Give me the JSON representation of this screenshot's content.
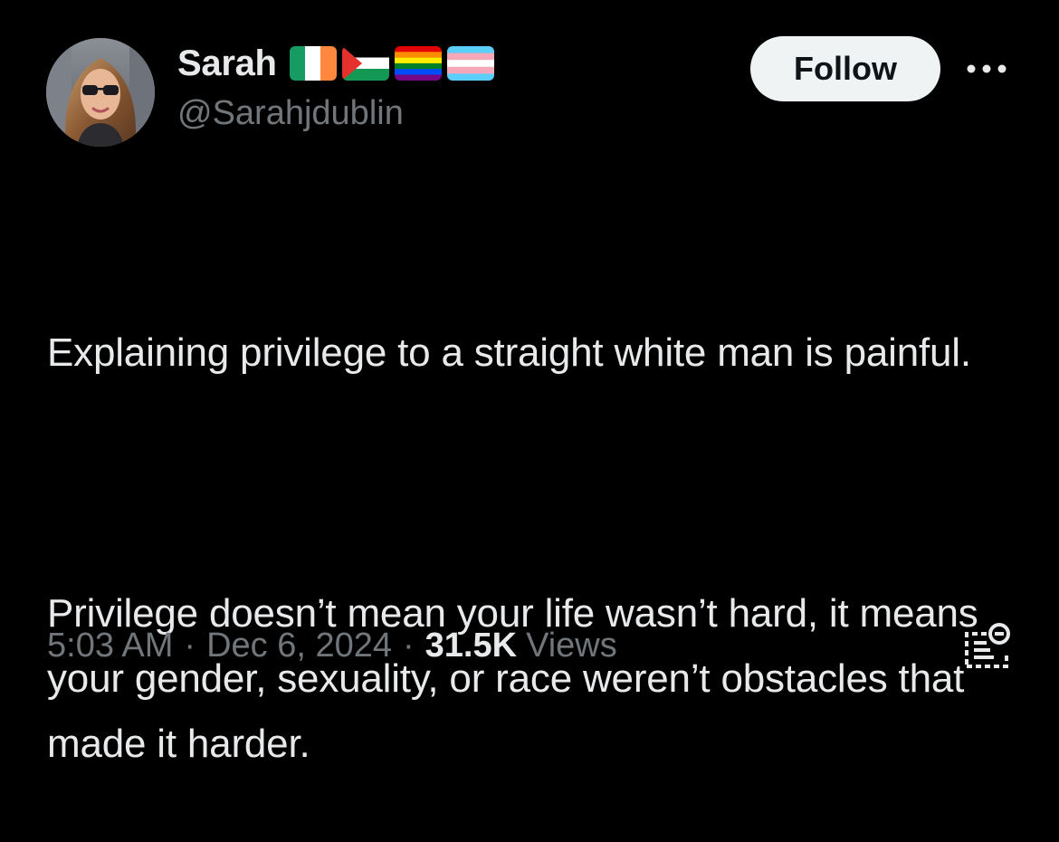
{
  "author": {
    "display_name": "Sarah",
    "handle": "@Sarahjdublin",
    "flags": [
      "ireland-flag",
      "palestine-flag",
      "rainbow-pride-flag",
      "transgender-flag"
    ]
  },
  "actions": {
    "follow_label": "Follow",
    "more_icon": "more-options-icon"
  },
  "tweet": {
    "paragraphs": [
      "Explaining privilege to a straight white man is painful.",
      "Privilege doesn’t mean your life wasn’t hard, it means your gender, sexuality, or race weren’t obstacles that made it harder."
    ]
  },
  "meta": {
    "time": "5:03 AM",
    "separator": "·",
    "date": "Dec 6, 2024",
    "views_count": "31.5K",
    "views_label": "Views"
  },
  "colors": {
    "background": "#000000",
    "primary_text": "#e7e9ea",
    "secondary_text": "#71767b",
    "follow_bg": "#eff3f4",
    "follow_text": "#0f1419"
  }
}
